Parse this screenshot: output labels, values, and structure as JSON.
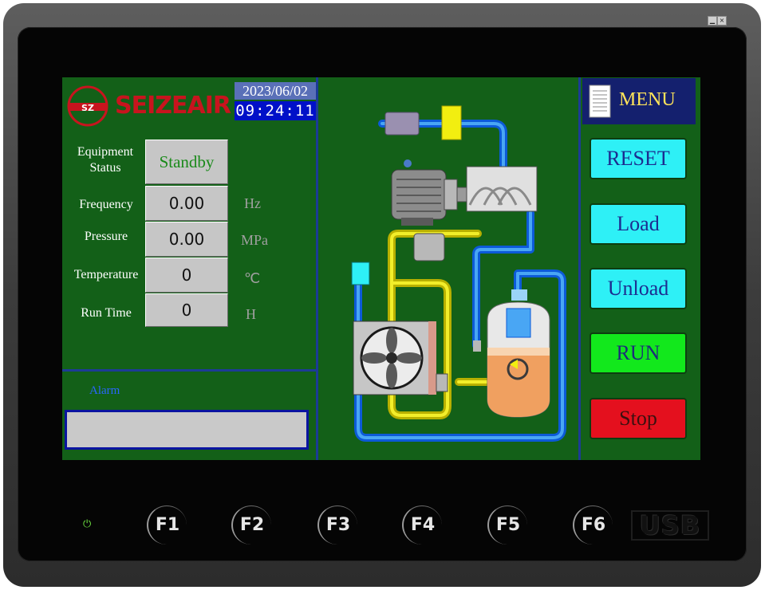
{
  "brand": {
    "name": "SEIZEAIR",
    "logo_mark": "SZ"
  },
  "clock": {
    "date": "2023/06/02",
    "time": "09:24:11"
  },
  "status": {
    "equipment_label_line1": "Equipment",
    "equipment_label_line2": "Status",
    "equipment_value": "Standby",
    "frequency_label": "Frequency",
    "frequency_value": "0.00",
    "frequency_unit": "Hz",
    "pressure_label": "Pressure",
    "pressure_value": "0.00",
    "pressure_unit": "MPa",
    "temperature_label": "Temperature",
    "temperature_value": "0",
    "temperature_unit": "℃",
    "runtime_label": "Run Time",
    "runtime_value": "0",
    "runtime_unit": "H"
  },
  "alarm": {
    "label": "Alarm",
    "text": ""
  },
  "menu": {
    "label": "MENU"
  },
  "buttons": {
    "reset": "RESET",
    "load": "Load",
    "unload": "Unload",
    "run": "RUN",
    "stop": "Stop"
  },
  "function_keys": [
    "F1",
    "F2",
    "F3",
    "F4",
    "F5",
    "F6"
  ],
  "usb_label": "USB",
  "power_icon": "power-icon",
  "colors": {
    "screen_bg": "#136018",
    "accent_cyan": "#2ef0f6",
    "run_green": "#12e81c",
    "stop_red": "#e4101e",
    "brand_red": "#c8141e"
  }
}
